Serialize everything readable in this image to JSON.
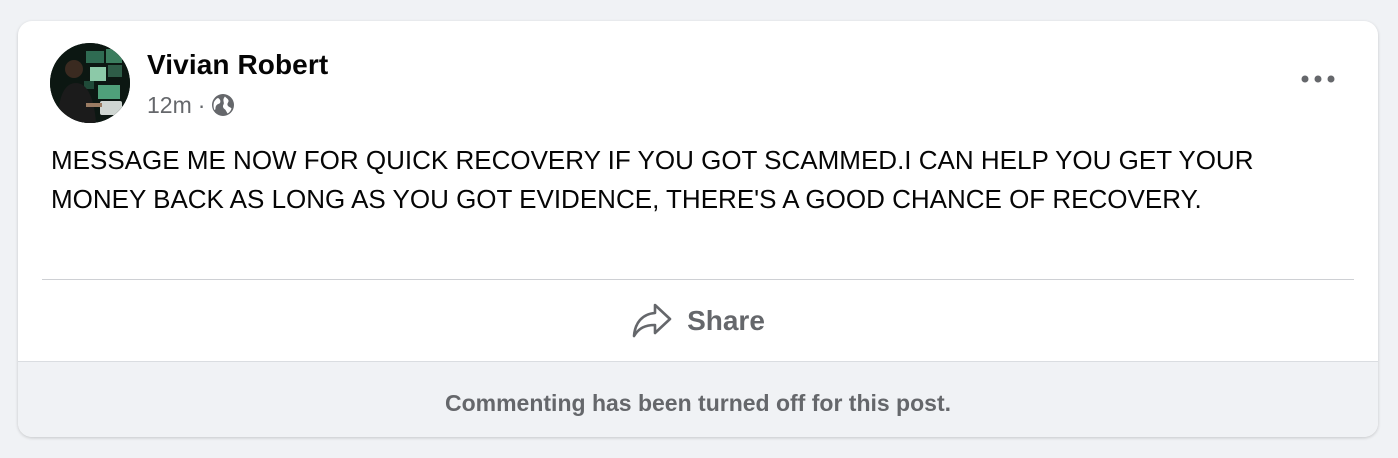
{
  "post": {
    "author": "Vivian Robert",
    "time": "12m",
    "separator": "·",
    "audience_icon": "globe-icon",
    "more_icon": "more-horizontal-icon",
    "text": "MESSAGE ME NOW FOR QUICK RECOVERY IF YOU GOT SCAMMED.I CAN HELP YOU GET YOUR MONEY BACK AS LONG AS YOU GOT EVIDENCE, THERE'S A GOOD CHANCE OF RECOVERY."
  },
  "actions": {
    "share_label": "Share",
    "share_icon": "share-arrow-icon"
  },
  "footer": {
    "comments_notice": "Commenting has been turned off for this post."
  },
  "colors": {
    "background": "#f0f2f5",
    "card": "#ffffff",
    "primary_text": "#050505",
    "secondary_text": "#65676b",
    "divider": "#ced0d4"
  }
}
